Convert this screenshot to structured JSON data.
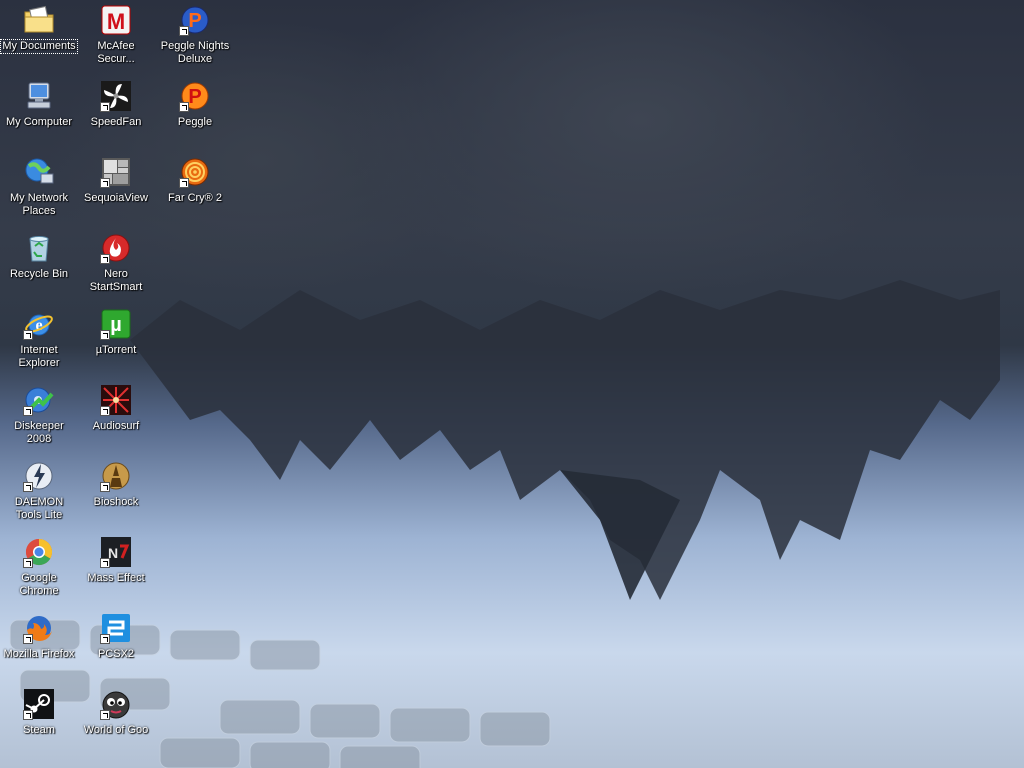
{
  "desktop": {
    "colors": {
      "label_text": "#ffffff",
      "label_shadow": "#000000"
    },
    "icons": [
      {
        "label": "My Documents",
        "icon": "folder-documents-icon",
        "shortcut": false,
        "selected": true
      },
      {
        "label": "McAfee Secur...",
        "icon": "mcafee-icon",
        "shortcut": false
      },
      {
        "label": "Peggle Nights Deluxe",
        "icon": "peggle-nights-icon",
        "shortcut": true
      },
      {
        "label": "My Computer",
        "icon": "computer-icon",
        "shortcut": false
      },
      {
        "label": "SpeedFan",
        "icon": "fan-icon",
        "shortcut": true
      },
      {
        "label": "Peggle",
        "icon": "peggle-icon",
        "shortcut": true
      },
      {
        "label": "My Network Places",
        "icon": "network-places-icon",
        "shortcut": false
      },
      {
        "label": "SequoiaView",
        "icon": "sequoiaview-icon",
        "shortcut": true
      },
      {
        "label": "Far Cry® 2",
        "icon": "farcry-icon",
        "shortcut": true
      },
      {
        "label": "Recycle Bin",
        "icon": "recycle-bin-icon",
        "shortcut": false
      },
      {
        "label": "Nero StartSmart",
        "icon": "nero-icon",
        "shortcut": true
      },
      {
        "label": "Internet Explorer",
        "icon": "internet-explorer-icon",
        "shortcut": true
      },
      {
        "label": "µTorrent",
        "icon": "utorrent-icon",
        "shortcut": true
      },
      {
        "label": "Diskeeper 2008",
        "icon": "diskeeper-icon",
        "shortcut": true
      },
      {
        "label": "Audiosurf",
        "icon": "audiosurf-icon",
        "shortcut": true
      },
      {
        "label": "DAEMON Tools Lite",
        "icon": "daemon-tools-icon",
        "shortcut": true
      },
      {
        "label": "Bioshock",
        "icon": "bioshock-icon",
        "shortcut": true
      },
      {
        "label": "Google Chrome",
        "icon": "chrome-icon",
        "shortcut": true
      },
      {
        "label": "Mass Effect",
        "icon": "mass-effect-icon",
        "shortcut": true
      },
      {
        "label": "Mozilla Firefox",
        "icon": "firefox-icon",
        "shortcut": true
      },
      {
        "label": "PCSX2",
        "icon": "pcsx2-icon",
        "shortcut": true
      },
      {
        "label": "Steam",
        "icon": "steam-icon",
        "shortcut": true
      },
      {
        "label": "World of Goo",
        "icon": "world-of-goo-icon",
        "shortcut": true
      }
    ]
  }
}
